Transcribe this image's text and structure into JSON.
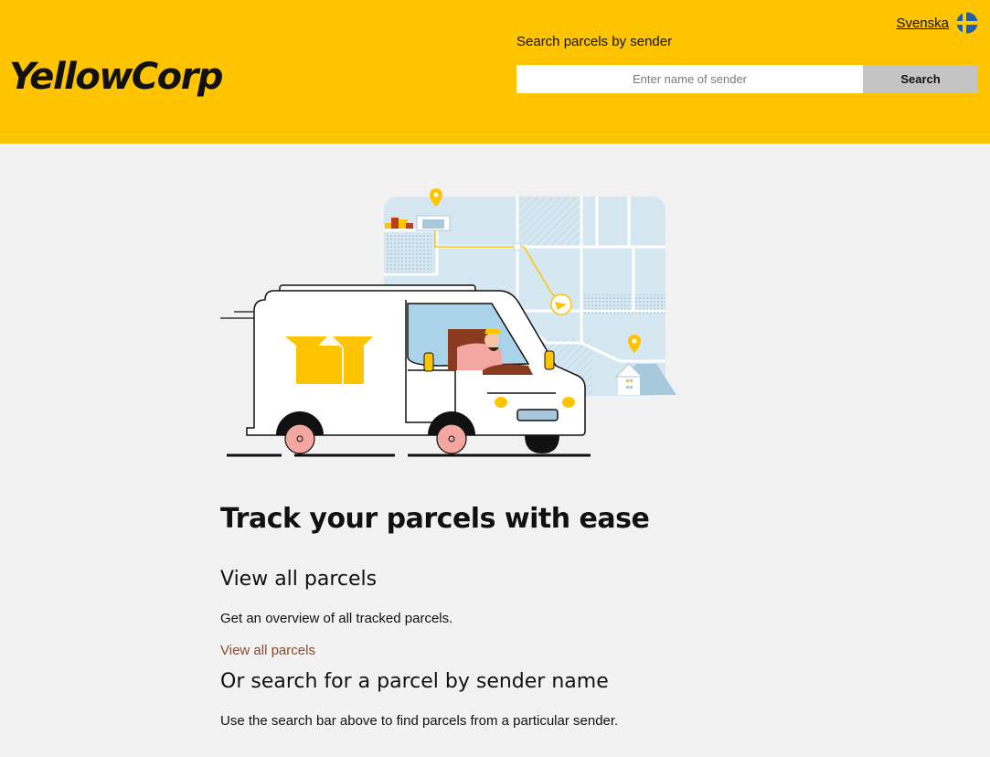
{
  "header": {
    "logo": "YellowCorp",
    "language_link": "Svenska",
    "flag_icon": "sweden-flag-icon",
    "search": {
      "label": "Search parcels by sender",
      "placeholder": "Enter name of sender",
      "value": "",
      "button_label": "Search"
    }
  },
  "hero": {
    "illustration": "delivery-van-map-illustration"
  },
  "main": {
    "title": "Track your parcels with ease",
    "view_all": {
      "heading": "View all parcels",
      "description": "Get an overview of all tracked parcels.",
      "link": "View all parcels"
    },
    "search_section": {
      "heading": "Or search for a parcel by sender name",
      "description": "Use the search bar above to find parcels from a particular sender."
    }
  },
  "colors": {
    "brand_yellow": "#ffc400",
    "page_background": "#f2f2f2",
    "search_button": "#c4c4c4",
    "link": "#8a4a2c"
  }
}
